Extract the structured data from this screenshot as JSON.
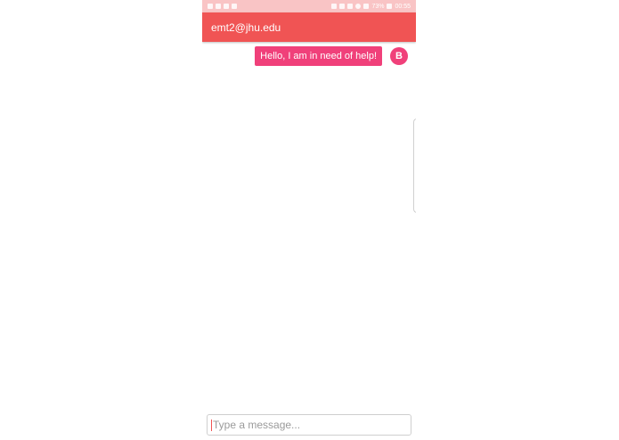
{
  "status_bar": {
    "battery": "73%",
    "time": "00:55",
    "left_icons": [
      "mute-icon",
      "vibrate-icon",
      "gallery-icon",
      "video-icon"
    ],
    "right_icons": [
      "bluetooth-icon",
      "nfc-icon",
      "sound-icon",
      "wifi-icon",
      "signal-icon",
      "battery-icon"
    ]
  },
  "header": {
    "title": "emt2@jhu.edu"
  },
  "messages": [
    {
      "text": "Hello, I am in need of help!",
      "avatar_initial": "B"
    }
  ],
  "composer": {
    "placeholder": "Type a message..."
  },
  "colors": {
    "status_bar": "#f9c4c5",
    "app_bar": "#f05454",
    "bubble": "#f0407a",
    "avatar": "#f0407a",
    "cursor": "#f05454"
  }
}
